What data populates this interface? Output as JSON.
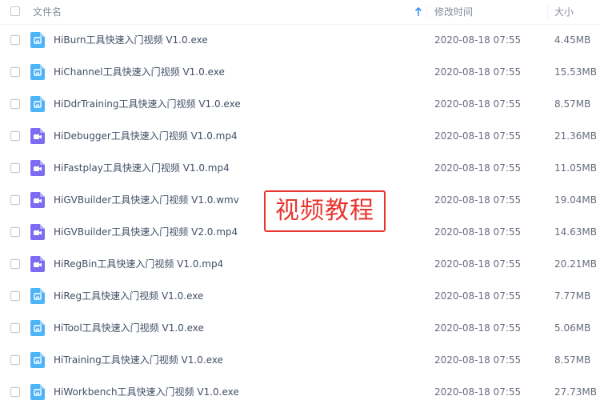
{
  "header": {
    "name_label": "文件名",
    "mtime_label": "修改时间",
    "size_label": "大小"
  },
  "colors": {
    "app_icon": "#4eb4f8",
    "video_icon": "#7d6cf0",
    "stamp": "#e8362f"
  },
  "files": [
    {
      "name": "HiBurn工具快速入门视频 V1.0.exe",
      "mtime": "2020-08-18 07:55",
      "size": "4.45MB",
      "icon": "app-icon"
    },
    {
      "name": "HiChannel工具快速入门视频 V1.0.exe",
      "mtime": "2020-08-18 07:55",
      "size": "15.53MB",
      "icon": "app-icon"
    },
    {
      "name": "HiDdrTraining工具快速入门视频 V1.0.exe",
      "mtime": "2020-08-18 07:55",
      "size": "8.57MB",
      "icon": "app-icon"
    },
    {
      "name": "HiDebugger工具快速入门视频 V1.0.mp4",
      "mtime": "2020-08-18 07:55",
      "size": "21.36MB",
      "icon": "video-icon"
    },
    {
      "name": "HiFastplay工具快速入门视频 V1.0.mp4",
      "mtime": "2020-08-18 07:55",
      "size": "11.05MB",
      "icon": "video-icon"
    },
    {
      "name": "HiGVBuilder工具快速入门视频 V1.0.wmv",
      "mtime": "2020-08-18 07:55",
      "size": "19.04MB",
      "icon": "video-icon"
    },
    {
      "name": "HiGVBuilder工具快速入门视频 V2.0.mp4",
      "mtime": "2020-08-18 07:55",
      "size": "14.63MB",
      "icon": "video-icon"
    },
    {
      "name": "HiRegBin工具快速入门视频 V1.0.mp4",
      "mtime": "2020-08-18 07:55",
      "size": "20.21MB",
      "icon": "video-icon"
    },
    {
      "name": "HiReg工具快速入门视频 V1.0.exe",
      "mtime": "2020-08-18 07:55",
      "size": "7.77MB",
      "icon": "app-icon"
    },
    {
      "name": "HiTool工具快速入门视频 V1.0.exe",
      "mtime": "2020-08-18 07:55",
      "size": "5.06MB",
      "icon": "app-icon"
    },
    {
      "name": "HiTraining工具快速入门视频 V1.0.exe",
      "mtime": "2020-08-18 07:55",
      "size": "8.57MB",
      "icon": "app-icon"
    },
    {
      "name": "HiWorkbench工具快速入门视频 V1.0.exe",
      "mtime": "2020-08-18 07:55",
      "size": "27.73MB",
      "icon": "app-icon"
    }
  ],
  "overlay": {
    "stamp_text": "视频教程"
  }
}
